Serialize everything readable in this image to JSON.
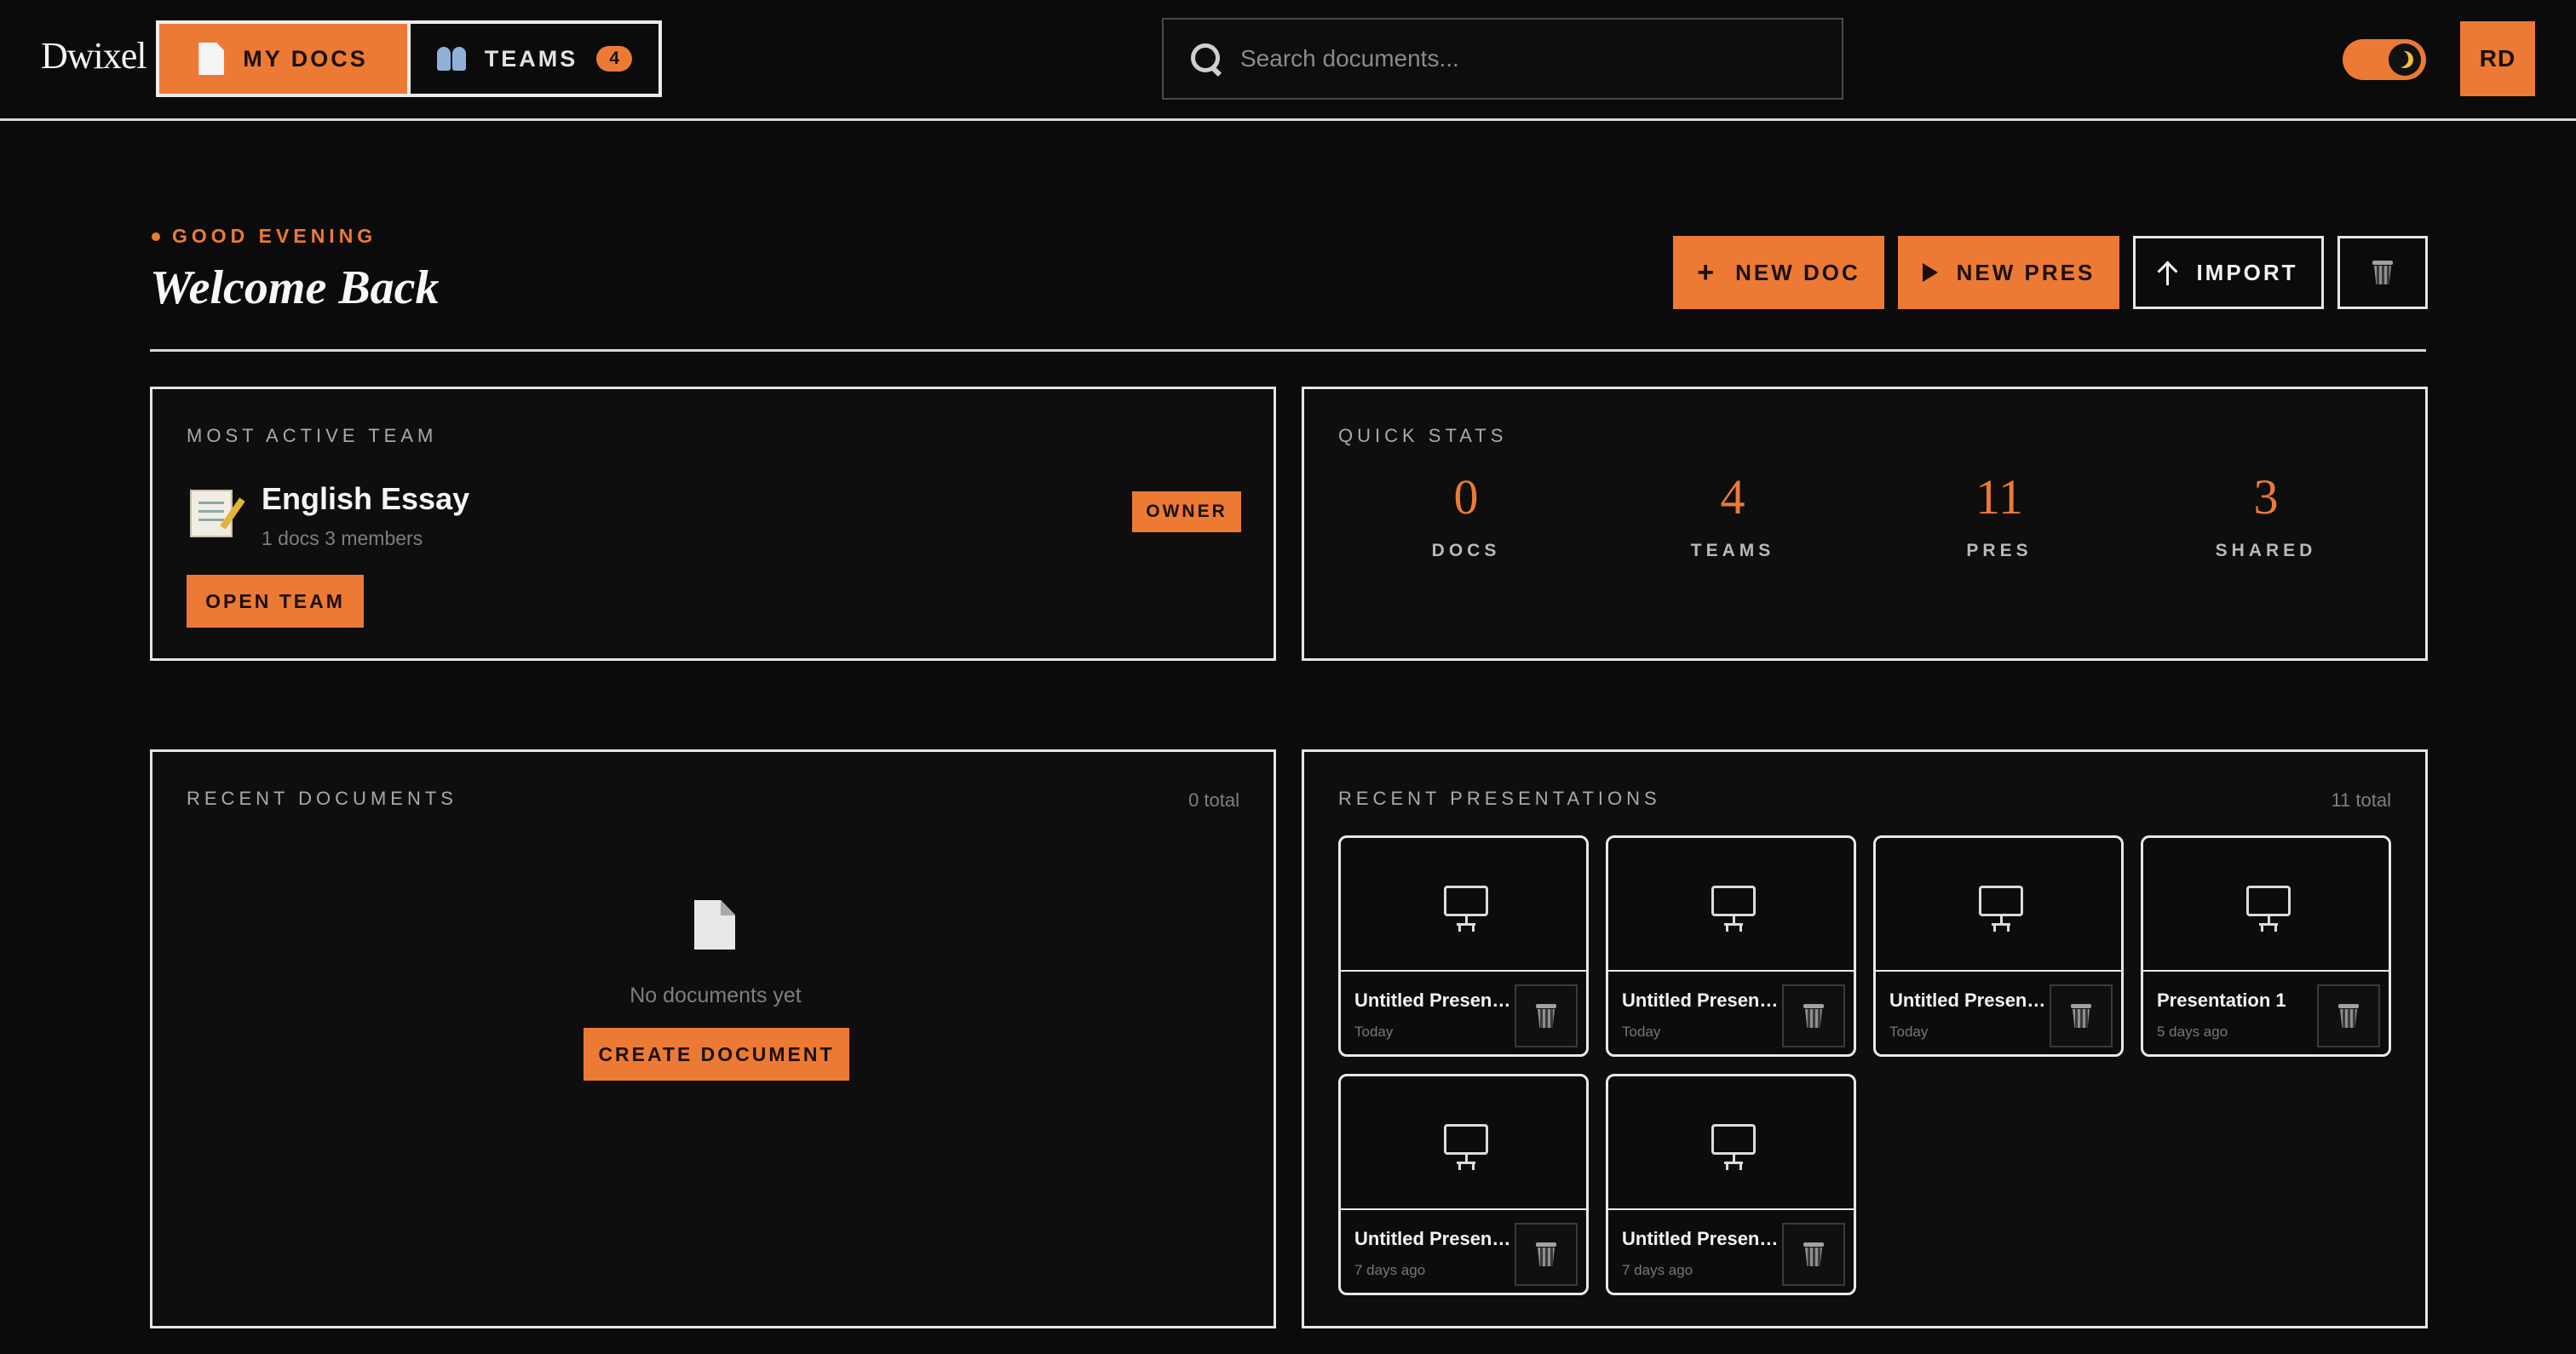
{
  "app": {
    "logo": "Dwixel"
  },
  "nav": {
    "tabs": [
      {
        "label": "MY DOCS",
        "icon": "document-icon",
        "active": true
      },
      {
        "label": "TEAMS",
        "icon": "people-icon",
        "badge": "4",
        "active": false
      }
    ]
  },
  "search": {
    "placeholder": "Search documents...",
    "value": ""
  },
  "theme_toggle": {
    "mode": "dark",
    "icon": "moon-icon"
  },
  "user": {
    "initials": "RD"
  },
  "greeting": {
    "eyebrow": "GOOD EVENING",
    "title": "Welcome Back"
  },
  "actions": {
    "new_doc": "NEW DOC",
    "new_pres": "NEW PRES",
    "import": "IMPORT",
    "trash_icon": "trash-icon"
  },
  "active_team": {
    "label": "MOST ACTIVE TEAM",
    "name": "English Essay",
    "meta": "1 docs 3 members",
    "role": "OWNER",
    "open_label": "OPEN TEAM",
    "icon": "memo-icon"
  },
  "stats": {
    "label": "QUICK STATS",
    "items": [
      {
        "value": "0",
        "label": "DOCS"
      },
      {
        "value": "4",
        "label": "TEAMS"
      },
      {
        "value": "11",
        "label": "PRES"
      },
      {
        "value": "3",
        "label": "SHARED"
      }
    ]
  },
  "recent_docs": {
    "label": "RECENT DOCUMENTS",
    "count": "0 total",
    "empty_text": "No documents yet",
    "create_label": "CREATE DOCUMENT"
  },
  "recent_pres": {
    "label": "RECENT PRESENTATIONS",
    "count": "11 total",
    "items": [
      {
        "name": "Untitled Presentation",
        "date": "Today"
      },
      {
        "name": "Untitled Presentation",
        "date": "Today"
      },
      {
        "name": "Untitled Presentation",
        "date": "Today"
      },
      {
        "name": "Presentation 1",
        "date": "5 days ago"
      },
      {
        "name": "Untitled Presentation",
        "date": "7 days ago"
      },
      {
        "name": "Untitled Presentation",
        "date": "7 days ago"
      }
    ]
  },
  "colors": {
    "accent": "#ec7a35",
    "background": "#0b0b0b",
    "border": "#e6e6e6"
  }
}
